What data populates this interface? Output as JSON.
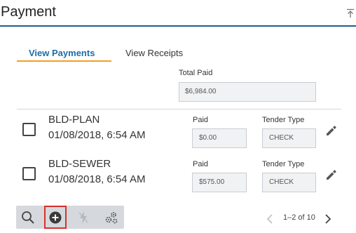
{
  "header": {
    "title": "Payment",
    "collapse_icon": "collapse-up-icon"
  },
  "tabs": [
    {
      "label": "View Payments",
      "active": true
    },
    {
      "label": "View Receipts",
      "active": false
    }
  ],
  "total": {
    "label": "Total Paid",
    "value": "$6,984.00"
  },
  "payments": [
    {
      "name": "BLD-PLAN",
      "date": "01/08/2018, 6:54 AM",
      "paid_label": "Paid",
      "paid": "$0.00",
      "tender_label": "Tender Type",
      "tender": "CHECK"
    },
    {
      "name": "BLD-SEWER",
      "date": "01/08/2018, 6:54 AM",
      "paid_label": "Paid",
      "paid": "$575.00",
      "tender_label": "Tender Type",
      "tender": "CHECK"
    }
  ],
  "toolbar": {
    "icons": [
      "search-icon",
      "add-circle-icon",
      "lightning-icon",
      "settings-gears-icon"
    ],
    "highlight_color": "#d9302b"
  },
  "pager": {
    "text": "1–2 of 10"
  },
  "colors": {
    "accent": "#1a6fa8",
    "tab_underline": "#f0a020",
    "header_rule": "#1f5f8f"
  }
}
